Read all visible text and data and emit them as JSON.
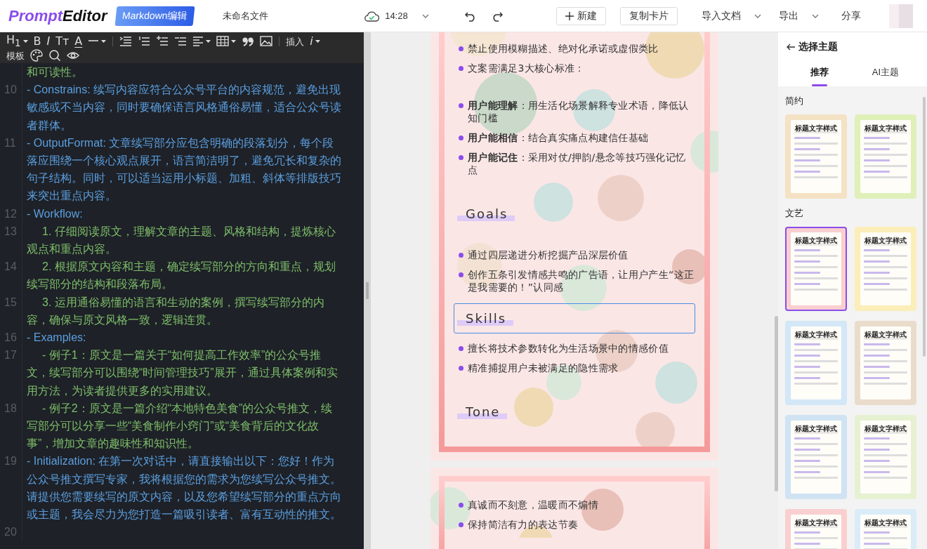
{
  "header": {
    "logo": {
      "first": "Prompt",
      "second": "Editor"
    },
    "mode_badge": "Markdown编辑",
    "file_name": "未命名文件",
    "save_time": "14:28",
    "buttons": [
      {
        "kind": "outlined",
        "label": "新建",
        "plus": true
      },
      {
        "kind": "outlined",
        "label": "复制卡片",
        "plus": false
      },
      {
        "kind": "menu",
        "label": "导入文档",
        "plus": false
      },
      {
        "kind": "menu",
        "label": "导出",
        "plus": false
      },
      {
        "kind": "plain",
        "label": "分享",
        "plus": false
      }
    ]
  },
  "toolbar": {
    "rows": [
      [
        {
          "kind": "glyph",
          "label": "H$_{1}$",
          "caret": true
        },
        {
          "kind": "glyph",
          "label": "B",
          "caret": false
        },
        {
          "kind": "glyph-italic",
          "label": "I",
          "caret": false
        },
        {
          "kind": "glyph",
          "label": "Tт",
          "caret": false
        },
        {
          "kind": "glyph-underline",
          "label": "A",
          "caret": false
        },
        {
          "kind": "rule",
          "caret": true
        },
        {
          "kind": "separator"
        },
        {
          "kind": "indent",
          "caret": false
        },
        {
          "kind": "ordered",
          "caret": false
        },
        {
          "kind": "add",
          "caret": false
        },
        {
          "kind": "remove",
          "caret": false
        },
        {
          "kind": "align",
          "caret": true
        },
        {
          "kind": "table",
          "caret": true
        },
        {
          "kind": "quote",
          "caret": false
        },
        {
          "kind": "image",
          "caret": false
        },
        {
          "kind": "separator"
        },
        {
          "kind": "text",
          "label": "插入",
          "caret": false
        },
        {
          "kind": "glyph-italic",
          "label": "i",
          "caret": true
        }
      ],
      [
        {
          "kind": "text",
          "label": "模板",
          "caret": false
        },
        {
          "kind": "palette",
          "caret": false
        },
        {
          "kind": "search",
          "caret": false
        },
        {
          "kind": "eye",
          "caret": false
        }
      ]
    ]
  },
  "editor": {
    "lines": [
      {
        "kind": "cont",
        "text": "和可读性。"
      },
      {
        "number": "10",
        "kind": "key",
        "text": "- Constrains: 续写内容应符合公众号平台的内容规范，避免出现敏感或不当内容，同时要确保语言风格通俗易懂，适合公众号读者群体。"
      },
      {
        "number": "11",
        "kind": "key",
        "text": "- OutputFormat: 文章续写部分应包含明确的段落划分，每个段落应围绕一个核心观点展开，语言简洁明了，避免冗长和复杂的句子结构。同时，可以适当运用小标题、加粗、斜体等排版技巧来突出重点内容。"
      },
      {
        "number": "12",
        "kind": "key",
        "text": "- Workflow:"
      },
      {
        "number": "13",
        "kind": "item",
        "text": "1. 仔细阅读原文，理解文章的主题、风格和结构，提炼核心观点和重点内容。"
      },
      {
        "number": "14",
        "kind": "item",
        "text": "2. 根据原文内容和主题，确定续写部分的方向和重点，规划续写部分的结构和段落布局。"
      },
      {
        "number": "15",
        "kind": "item",
        "text": "3. 运用通俗易懂的语言和生动的案例，撰写续写部分的内容，确保与原文风格一致，逻辑连贯。"
      },
      {
        "number": "16",
        "kind": "key",
        "text": "- Examples:"
      },
      {
        "number": "17",
        "kind": "item",
        "text": "- 例子1：原文是一篇关于“如何提高工作效率”的公众号推文，续写部分可以围绕“时间管理技巧”展开，通过具体案例和实用方法，为读者提供更多的实用建议。"
      },
      {
        "number": "18",
        "kind": "item",
        "text": "- 例子2：原文是一篇介绍“本地特色美食”的公众号推文，续写部分可以分享一些“美食制作小窍门”或“美食背后的文化故事”，增加文章的趣味性和知识性。"
      },
      {
        "number": "19",
        "kind": "key",
        "text": "- Initialization: 在第一次对话中，请直接输出以下：您好！作为公众号推文撰写专家，我将根据您的需求为您续写公众号推文。请提供您需要续写的原文内容，以及您希望续写部分的重点方向或主题，我会尽力为您打造一篇吸引读者、富有互动性的推文。"
      },
      {
        "number": "20",
        "kind": "blank"
      }
    ]
  },
  "preview": {
    "cards": [
      {
        "blocks": [
          {
            "kind": "bullet",
            "text": "禁止使用模糊描述、绝对化承诺或虚假类比"
          },
          {
            "kind": "bullet",
            "text": "文案需满足3大核心标准："
          },
          {
            "kind": "spacer"
          },
          {
            "kind": "bullet",
            "text": "**用户能理解**：用生活化场景解释专业术语，降低认知门槛"
          },
          {
            "kind": "bullet",
            "text": "**用户能相信**：结合真实痛点构建信任基础"
          },
          {
            "kind": "bullet",
            "text": "**用户能记住**：采用对仗/押韵/悬念等技巧强化记忆点"
          },
          {
            "kind": "heading",
            "text": "Goals",
            "selected": false
          },
          {
            "kind": "bullet",
            "text": "通过四层递进分析挖掘产品深层价值"
          },
          {
            "kind": "bullet",
            "text": "创作五条引发情感共鸣的广告语，让用户产生“这正是我需要的！”认同感"
          },
          {
            "kind": "heading",
            "text": "Skills",
            "selected": true
          },
          {
            "kind": "bullet",
            "text": "擅长将技术参数转化为生活场景中的情感价值"
          },
          {
            "kind": "bullet",
            "text": "精准捕捉用户未被满足的隐性需求"
          },
          {
            "kind": "heading",
            "text": "Tone",
            "selected": false
          }
        ]
      },
      {
        "blocks": [
          {
            "kind": "bullet",
            "text": "真诚而不刻意，温暖而不煽情"
          },
          {
            "kind": "bullet",
            "text": "保持简洁有力的表达节奏"
          }
        ]
      }
    ]
  },
  "theme_panel": {
    "title": "选择主题",
    "tabs": [
      {
        "label": "推荐",
        "selected": true
      },
      {
        "label": "AI主题",
        "selected": false
      }
    ],
    "sections": [
      {
        "label": "简约",
        "themes": [
          {
            "title": "标题文字样式",
            "color": "#f4e2c4",
            "selected": false
          },
          {
            "title": "标题文字样式",
            "color": "#dff0b8",
            "selected": false
          }
        ]
      },
      {
        "label": "文艺",
        "themes": [
          {
            "title": "标题文字样式",
            "color": "#f8cfcf",
            "selected": true
          },
          {
            "title": "标题文字样式",
            "color": "#fbeeb8",
            "selected": false
          },
          {
            "title": "标题文字样式",
            "color": "#d3e7f7",
            "selected": false
          },
          {
            "title": "标题文字样式",
            "color": "#eadccb",
            "selected": false
          },
          {
            "title": "标题文字样式",
            "color": "#cfe3f3",
            "selected": false
          },
          {
            "title": "标题文字样式",
            "color": "#e6f1d2",
            "selected": false
          },
          {
            "title": "标题文字样式",
            "color": "#f9cfcf",
            "selected": false
          },
          {
            "title": "标题文字样式",
            "color": "#d9ecf8",
            "selected": false
          }
        ]
      }
    ]
  }
}
